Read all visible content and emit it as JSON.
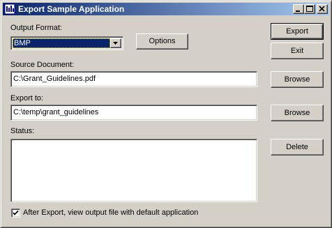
{
  "window": {
    "title": "Export Sample Application",
    "title_gradient": [
      "#0a246a",
      "#a6caf0"
    ],
    "face_color": "#d4d0c8"
  },
  "caption_buttons": {
    "minimize_icon": "minimize-icon",
    "maximize_icon": "maximize-icon",
    "close_icon": "close-icon"
  },
  "form": {
    "output_format_label": "Output Format:",
    "output_format_value": "BMP",
    "options_label": "Options",
    "source_label": "Source Document:",
    "source_value": "C:\\Grant_Guidelines.pdf",
    "export_to_label": "Export to:",
    "export_to_value": "C:\\temp\\grant_guidelines",
    "status_label": "Status:",
    "status_value": "",
    "checkbox_label": "After Export, view output file with default application",
    "checkbox_checked": true
  },
  "buttons": {
    "export": "Export",
    "exit": "Exit",
    "browse_source": "Browse",
    "browse_export": "Browse",
    "delete": "Delete"
  }
}
